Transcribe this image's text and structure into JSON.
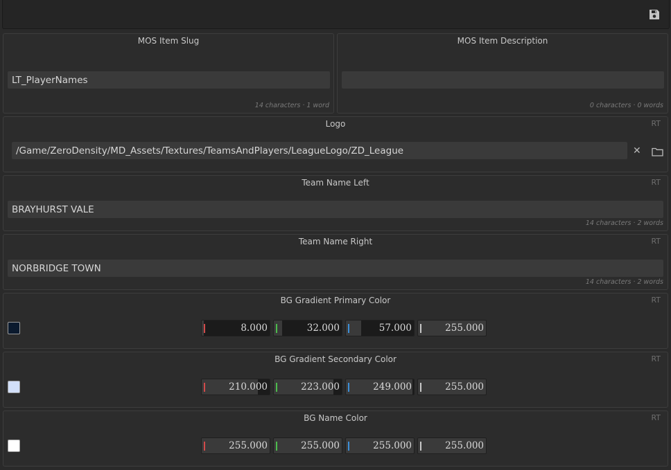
{
  "toolbar": {
    "save_icon": "floppy-disk-icon"
  },
  "mos_slug": {
    "title": "MOS Item Slug",
    "value": "LT_PlayerNames",
    "counter": "14 characters · 1 word"
  },
  "mos_desc": {
    "title": "MOS Item Description",
    "value": "",
    "counter": "0 characters · 0 words"
  },
  "logo": {
    "title": "Logo",
    "rt": "RT",
    "path": "/Game/ZeroDensity/MD_Assets/Textures/TeamsAndPlayers/LeagueLogo/ZD_League",
    "clear_glyph": "✕",
    "folder_icon": "folder-icon"
  },
  "team_left": {
    "title": "Team Name Left",
    "rt": "RT",
    "value": "BRAYHURST VALE",
    "counter": "14 characters · 2 words"
  },
  "team_right": {
    "title": "Team Name Right",
    "rt": "RT",
    "value": "NORBRIDGE TOWN",
    "counter": "14 characters · 2 words"
  },
  "colors": [
    {
      "title": "BG Gradient Primary Color",
      "rt": "RT",
      "swatch": "#0b1a2e",
      "r": "8.000",
      "g": "32.000",
      "b": "57.000",
      "a": "255.000",
      "r_frac": 0.031,
      "g_frac": 0.125,
      "b_frac": 0.224,
      "a_frac": 1.0
    },
    {
      "title": "BG Gradient Secondary Color",
      "rt": "RT",
      "swatch": "#d2dff9",
      "r": "210.000",
      "g": "223.000",
      "b": "249.000",
      "a": "255.000",
      "r_frac": 0.824,
      "g_frac": 0.875,
      "b_frac": 0.976,
      "a_frac": 1.0
    },
    {
      "title": "BG Name Color",
      "rt": "RT",
      "swatch": "#ffffff",
      "r": "255.000",
      "g": "255.000",
      "b": "255.000",
      "a": "255.000",
      "r_frac": 1.0,
      "g_frac": 1.0,
      "b_frac": 1.0,
      "a_frac": 1.0
    }
  ],
  "channel_colors": {
    "r": "#d24a4a",
    "g": "#4cbc4c",
    "b": "#3d8fd8",
    "a": "#c8c8c8"
  }
}
